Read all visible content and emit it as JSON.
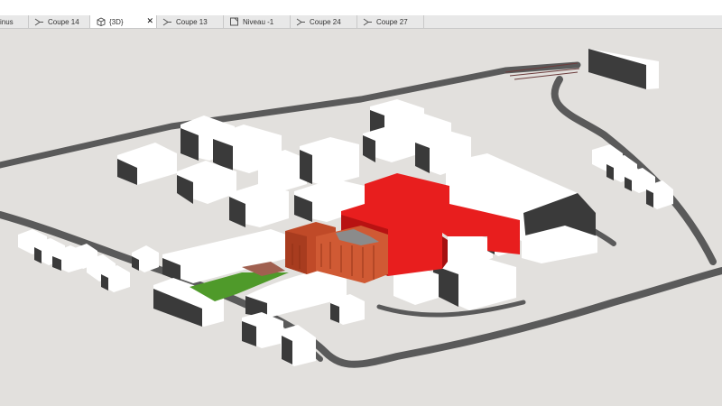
{
  "tabs": [
    {
      "label": "inus",
      "icon": "section-icon",
      "active": false
    },
    {
      "label": "Coupe 14",
      "icon": "section-icon",
      "active": false
    },
    {
      "label": "{3D}",
      "icon": "3d-view-icon",
      "active": true,
      "close": "✕"
    },
    {
      "label": "Coupe 13",
      "icon": "section-icon",
      "active": false
    },
    {
      "label": "Niveau -1",
      "icon": "plan-view-icon",
      "active": false
    },
    {
      "label": "Coupe 24",
      "icon": "section-icon",
      "active": false
    },
    {
      "label": "Coupe 27",
      "icon": "section-icon",
      "active": false
    }
  ],
  "colors": {
    "background": "#e2e0dd",
    "road": "#5a5a5a",
    "building_white": "#ffffff",
    "building_side": "#3c3c3c",
    "highlight_red": "#e81e1e",
    "brick": "#c04a28",
    "lawn": "#4f9a2a"
  }
}
